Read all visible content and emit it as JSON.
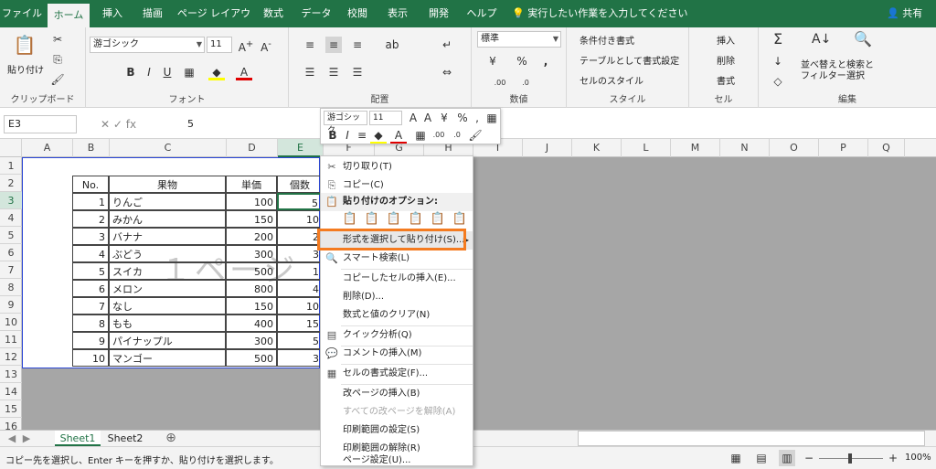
{
  "tabs": [
    "ファイル",
    "ホーム",
    "挿入",
    "描画",
    "ページ レイアウト",
    "数式",
    "データ",
    "校閲",
    "表示",
    "開発",
    "ヘルプ"
  ],
  "tell_me": "実行したい作業を入力してください",
  "share": "共有",
  "ribbon": {
    "paste_label": "貼り付け",
    "font_name": "游ゴシック",
    "font_size": "11",
    "number_format": "標準",
    "cond_format": "条件付き書式",
    "table_format": "テーブルとして書式設定",
    "cell_styles": "セルのスタイル",
    "insert": "挿入",
    "delete": "削除",
    "format": "書式",
    "sort_filter": "並べ替えと\nフィルター",
    "find_select": "検索と\n選択",
    "groups": [
      "クリップボード",
      "フォント",
      "配置",
      "数値",
      "スタイル",
      "セル",
      "編集"
    ]
  },
  "formula_bar": {
    "name_box": "E3",
    "fx": "fx",
    "value": "5"
  },
  "columns": [
    "A",
    "B",
    "C",
    "D",
    "E",
    "F",
    "G",
    "H",
    "I",
    "J",
    "K",
    "L",
    "M",
    "N",
    "O",
    "P",
    "Q"
  ],
  "rows": [
    "1",
    "2",
    "3",
    "4",
    "5",
    "6",
    "7",
    "8",
    "9",
    "10",
    "11",
    "12",
    "13",
    "14",
    "15",
    "16"
  ],
  "table": {
    "headers": [
      "No.",
      "果物",
      "単価",
      "個数"
    ],
    "rows": [
      [
        "1",
        "りんご",
        "100",
        "5"
      ],
      [
        "2",
        "みかん",
        "150",
        "10"
      ],
      [
        "3",
        "バナナ",
        "200",
        "2"
      ],
      [
        "4",
        "ぶどう",
        "300",
        "3"
      ],
      [
        "5",
        "スイカ",
        "500",
        "1"
      ],
      [
        "6",
        "メロン",
        "800",
        "4"
      ],
      [
        "7",
        "なし",
        "150",
        "10"
      ],
      [
        "8",
        "もも",
        "400",
        "15"
      ],
      [
        "9",
        "パイナップル",
        "300",
        "5"
      ],
      [
        "10",
        "マンゴー",
        "500",
        "3"
      ]
    ]
  },
  "watermark": "１ページ",
  "mini_toolbar": {
    "font": "游ゴシック",
    "size": "11"
  },
  "context_menu": {
    "cut": "切り取り(T)",
    "copy": "コピー(C)",
    "paste_options": "貼り付けのオプション:",
    "paste_special": "形式を選択して貼り付け(S)...",
    "smart_lookup": "スマート検索(L)",
    "insert_copied": "コピーしたセルの挿入(E)...",
    "delete": "削除(D)...",
    "clear": "数式と値のクリア(N)",
    "quick_analysis": "クイック分析(Q)",
    "insert_comment": "コメントの挿入(M)",
    "format_cells": "セルの書式設定(F)...",
    "insert_page_break": "改ページの挿入(B)",
    "reset_page_breaks": "すべての改ページを解除(A)",
    "set_print_area": "印刷範囲の設定(S)",
    "clear_print_area": "印刷範囲の解除(R)",
    "page_setup": "ページ設定(U)..."
  },
  "sheets": [
    "Sheet1",
    "Sheet2"
  ],
  "status_text": "コピー先を選択し、Enter キーを押すか、貼り付けを選択します。",
  "zoom": "100%",
  "colors": {
    "accent": "#217346",
    "highlight": "#f47b20"
  }
}
